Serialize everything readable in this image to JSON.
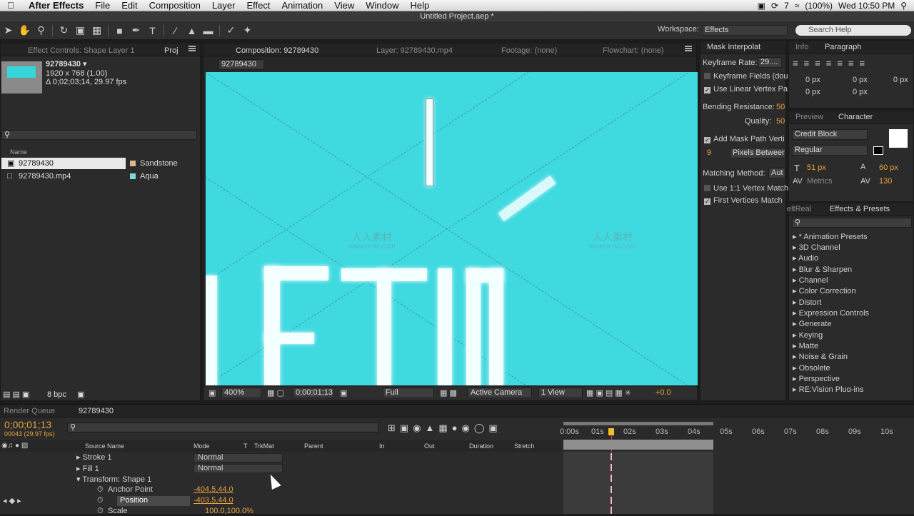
{
  "menubar": {
    "app": "After Effects",
    "items": [
      "File",
      "Edit",
      "Composition",
      "Layer",
      "Effect",
      "Animation",
      "View",
      "Window",
      "Help"
    ],
    "status_battery": "(100%)",
    "status_clock": "Wed 10:50 PM",
    "status_num": "7"
  },
  "window_title": "Untitled Project.aep *",
  "toolbar": {
    "workspace_label": "Workspace:",
    "workspace_value": "Effects",
    "search_placeholder": "Search Help"
  },
  "project_panel": {
    "tab_effect_controls": "Effect Controls: Shape Layer 1",
    "tab_project": "Proj",
    "item_name": "92789430 ▾",
    "item_res": "1920 x 768 (1.00)",
    "item_dur": "Δ 0;02;03;14, 29.97 fps",
    "col_name": "Name",
    "rows": [
      {
        "name": "92789430",
        "label": "Sandstone",
        "color": "#d8b98a"
      },
      {
        "name": "92789430.mp4",
        "label": "Aqua",
        "color": "#7fd7d7"
      }
    ],
    "bpc": "8 bpc"
  },
  "comp_panel": {
    "tab_comp": "Composition: 92789430",
    "tab_layer": "Layer: 92789430.mp4",
    "tab_footage": "Footage: (none)",
    "tab_flowchart": "Flowchart: (none)",
    "comp_name": "92789430",
    "zoom": "400%",
    "timecode": "0;00;01;13",
    "resolution": "Full",
    "camera": "Active Camera",
    "views": "1 View",
    "exposure": "+0.0",
    "watermark_text": "人人素材",
    "watermark_url": "www.rr-sc.com"
  },
  "mask_panel": {
    "tab": "Mask Interpolat",
    "keyframe_rate_label": "Keyframe Rate:",
    "keyframe_rate_value": "29....",
    "keyframe_fields": "Keyframe Fields (dou",
    "linear_vertex": "Use Linear Vertex Pa",
    "bending_label": "Bending Resistance:",
    "bending_value": "50",
    "quality_label": "Quality:",
    "quality_value": "50",
    "add_vertices": "Add Mask Path Verti",
    "vertex_num": "9",
    "pixels_between": "Pixels Between",
    "matching_label": "Matching Method:",
    "matching_value": "Aut",
    "use_vertex_match": "Use 1:1 Vertex Match",
    "first_vertices": "First Vertices Match"
  },
  "paragraph_panel": {
    "tab_info": "Info",
    "tab_paragraph": "Paragraph",
    "px_values": [
      "0 px",
      "0 px",
      "0 px",
      "0 px",
      "0 px"
    ]
  },
  "character_panel": {
    "tab_preview": "Preview",
    "tab_character": "Character",
    "font": "Credit Block",
    "style": "Regular",
    "size": "51 px",
    "leading": "60 px",
    "kerning": "Metrics",
    "tracking": "130"
  },
  "effects_panel": {
    "tab_left": "eltReal",
    "tab": "Effects & Presets",
    "items": [
      "* Animation Presets",
      "3D Channel",
      "Audio",
      "Blur & Sharpen",
      "Channel",
      "Color Correction",
      "Distort",
      "Expression Controls",
      "Generate",
      "Keying",
      "Matte",
      "Noise & Grain",
      "Obsolete",
      "Perspective",
      "RE:Vision Plug-ins"
    ]
  },
  "timeline": {
    "tab_render": "Render Queue",
    "tab_comp": "92789430",
    "timecode": "0;00;01;13",
    "frame_info": "00043 (29.97 fps)",
    "cols": [
      "Source Name",
      "Mode",
      "T",
      "TrkMat",
      "Parent",
      "In",
      "Out",
      "Duration",
      "Stretch"
    ],
    "ticks": [
      "0:00s",
      "01s",
      "02s",
      "03s",
      "04s",
      "05s",
      "06s",
      "07s",
      "08s",
      "09s",
      "10s"
    ],
    "layers": [
      {
        "name": "Stroke 1",
        "mode": "Normal"
      },
      {
        "name": "Fill 1",
        "mode": "Normal"
      },
      {
        "name": "Transform: Shape 1"
      }
    ],
    "props": [
      {
        "name": "Anchor Point",
        "value": "-404.5,44.0"
      },
      {
        "name": "Position",
        "value": "-403.5,44.0"
      },
      {
        "name": "Scale",
        "value": "100.0,100.0%"
      }
    ]
  }
}
